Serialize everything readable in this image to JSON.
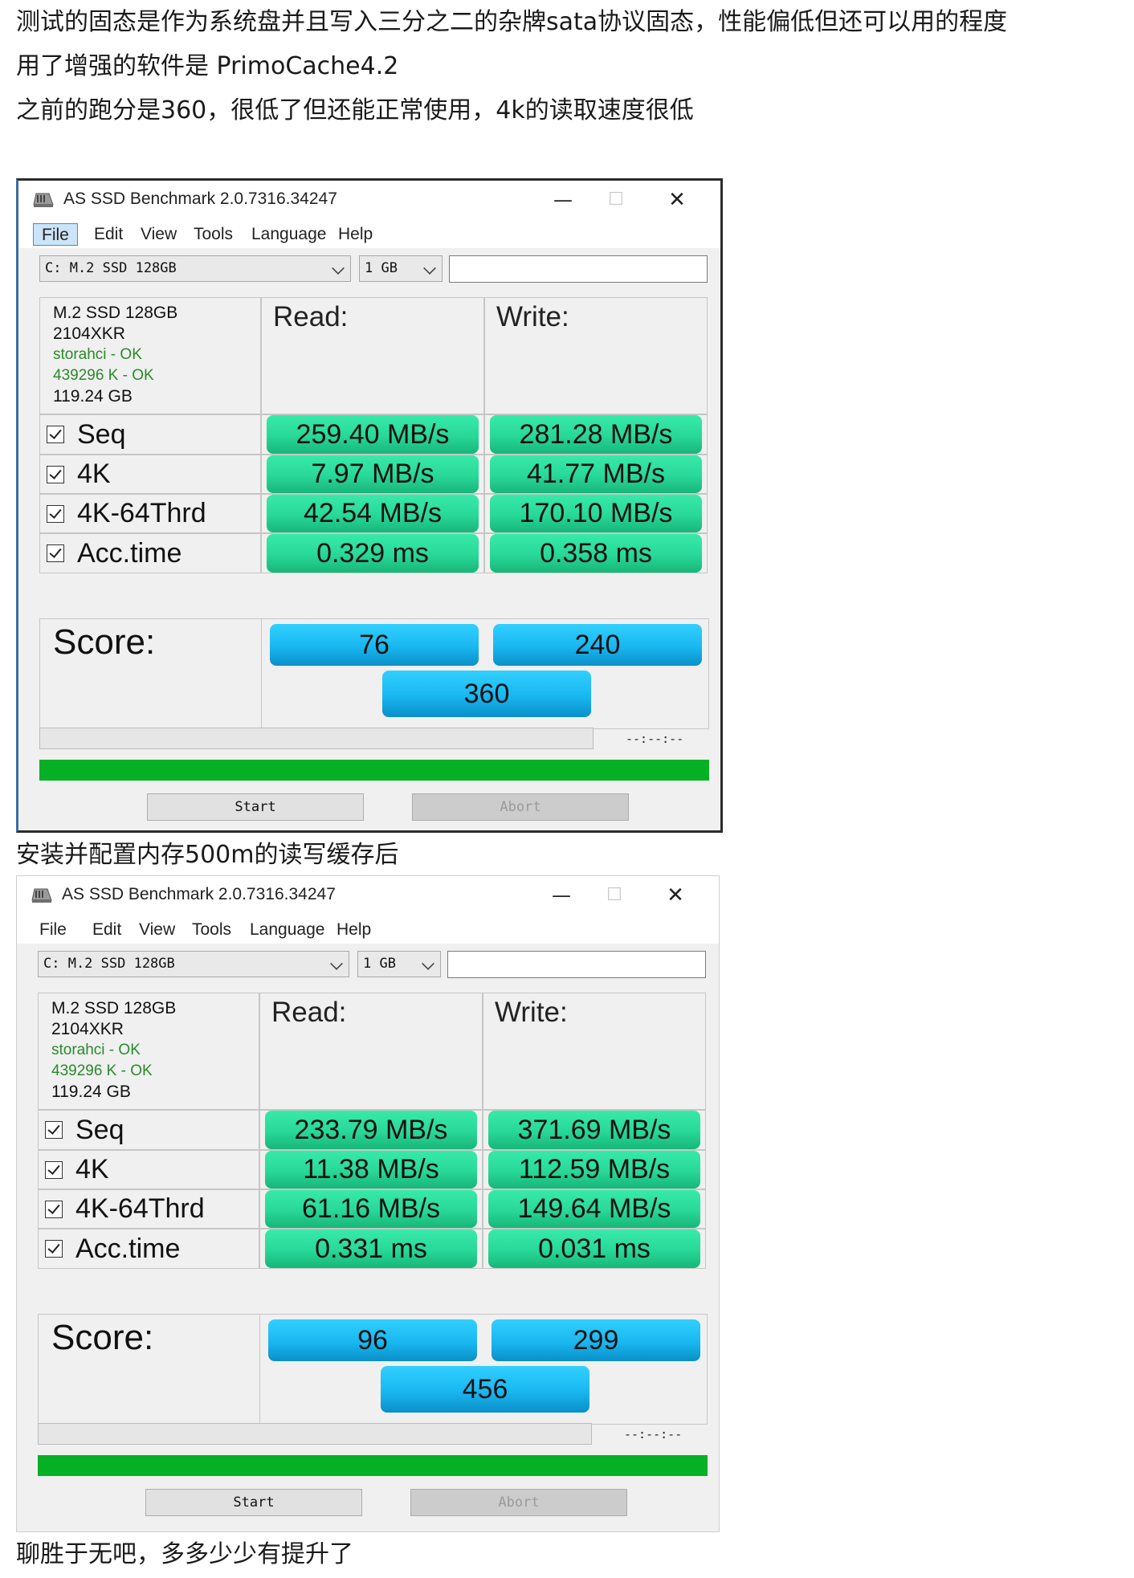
{
  "text": {
    "intro_line1": "测试的固态是作为系统盘并且写入三分之二的杂牌sata协议固态，性能偏低但还可以用的程度",
    "intro_line2": "用了增强的软件是 PrimoCache4.2",
    "intro_line3": "之前的跑分是360，很低了但还能正常使用，4k的读取速度很低",
    "middle": "安装并配置内存500m的读写缓存后",
    "outro": "聊胜于无吧，多多少少有提升了"
  },
  "windows": [
    {
      "title": "AS SSD Benchmark 2.0.7316.34247",
      "controls": {
        "minimize": "—",
        "maximize": "☐",
        "close": "✕"
      },
      "menu": [
        "File",
        "Edit",
        "View",
        "Tools",
        "Language",
        "Help"
      ],
      "active_menu": "File",
      "drive_select": "C: M.2 SSD 128GB",
      "size_select": "1 GB",
      "drive_info": {
        "name": "M.2 SSD 128GB",
        "firmware": "2104XKR",
        "driver": "storahci - OK",
        "align": "439296 K - OK",
        "capacity": "119.24 GB"
      },
      "read_label": "Read:",
      "write_label": "Write:",
      "rows": [
        {
          "label": "Seq",
          "read": "259.40 MB/s",
          "write": "281.28 MB/s"
        },
        {
          "label": "4K",
          "read": "7.97 MB/s",
          "write": "41.77 MB/s"
        },
        {
          "label": "4K-64Thrd",
          "read": "42.54 MB/s",
          "write": "170.10 MB/s"
        },
        {
          "label": "Acc.time",
          "read": "0.329 ms",
          "write": "0.358 ms"
        }
      ],
      "score_label": "Score:",
      "score_read": "76",
      "score_write": "240",
      "score_total": "360",
      "time": "--:--:--",
      "progress": 1.0,
      "start_label": "Start",
      "abort_label": "Abort"
    },
    {
      "title": "AS SSD Benchmark 2.0.7316.34247",
      "controls": {
        "minimize": "—",
        "maximize": "☐",
        "close": "✕"
      },
      "menu": [
        "File",
        "Edit",
        "View",
        "Tools",
        "Language",
        "Help"
      ],
      "active_menu": "",
      "drive_select": "C: M.2 SSD 128GB",
      "size_select": "1 GB",
      "drive_info": {
        "name": "M.2 SSD 128GB",
        "firmware": "2104XKR",
        "driver": "storahci - OK",
        "align": "439296 K - OK",
        "capacity": "119.24 GB"
      },
      "read_label": "Read:",
      "write_label": "Write:",
      "rows": [
        {
          "label": "Seq",
          "read": "233.79 MB/s",
          "write": "371.69 MB/s"
        },
        {
          "label": "4K",
          "read": "11.38 MB/s",
          "write": "112.59 MB/s"
        },
        {
          "label": "4K-64Thrd",
          "read": "61.16 MB/s",
          "write": "149.64 MB/s"
        },
        {
          "label": "Acc.time",
          "read": "0.331 ms",
          "write": "0.031 ms"
        }
      ],
      "score_label": "Score:",
      "score_read": "96",
      "score_write": "299",
      "score_total": "456",
      "time": "--:--:--",
      "progress": 1.0,
      "start_label": "Start",
      "abort_label": "Abort"
    }
  ]
}
